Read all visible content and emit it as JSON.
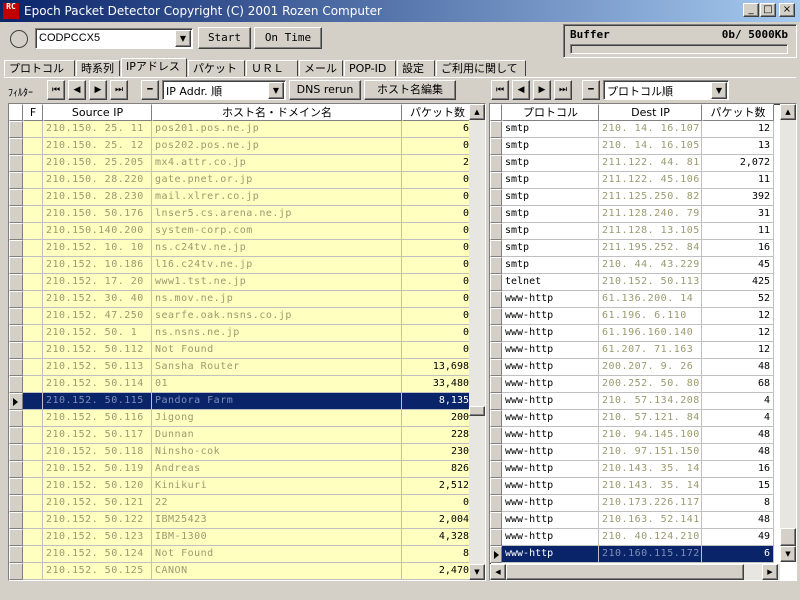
{
  "window": {
    "title": "Epoch Packet Detector   Copyright (C) 2001 Rozen Computer",
    "icon_text": "RC",
    "min_label": "_",
    "max_label": "□",
    "close_label": "×"
  },
  "toolbar": {
    "device": "CODPCCX5",
    "start_label": "Start",
    "ontime_label": "On Time",
    "buffer_label": "Buffer",
    "buffer_value": "0b/  5000Kb",
    "buffer_fill": 0
  },
  "tabs": [
    "プロトコル",
    "時系列",
    "IPアドレス",
    "パケット",
    "ＵＲＬ",
    "メール",
    "POP-ID",
    "設定",
    "ご利用に関して"
  ],
  "active_tab": 2,
  "filter": {
    "label": "ﾌｨﾙﾀｰ",
    "first": "⏮",
    "prev": "◀",
    "next": "▶",
    "last": "⏭",
    "minus": "━",
    "left_sort": "IP Addr. 順",
    "dns_label": "DNS rerun",
    "host_edit_label": "ホスト名編集",
    "right_sort": "プロトコル順"
  },
  "left_grid": {
    "headers": [
      "F",
      "Source IP",
      "ホスト名・ドメイン名",
      "パケット数"
    ],
    "selected_row": 16,
    "rows": [
      {
        "ip": "210.150. 25. 11",
        "host": "pos201.pos.ne.jp",
        "count": "6"
      },
      {
        "ip": "210.150. 25. 12",
        "host": "pos202.pos.ne.jp",
        "count": "0"
      },
      {
        "ip": "210.150. 25.205",
        "host": "mx4.attr.co.jp",
        "count": "2"
      },
      {
        "ip": "210.150. 28.220",
        "host": "gate.pnet.or.jp",
        "count": "0"
      },
      {
        "ip": "210.150. 28.230",
        "host": "mail.xlrer.co.jp",
        "count": "0"
      },
      {
        "ip": "210.150. 50.176",
        "host": "lnser5.cs.arena.ne.jp",
        "count": "0"
      },
      {
        "ip": "210.150.140.200",
        "host": "system-corp.com",
        "count": "0"
      },
      {
        "ip": "210.152. 10. 10",
        "host": "ns.c24tv.ne.jp",
        "count": "0"
      },
      {
        "ip": "210.152. 10.186",
        "host": "l16.c24tv.ne.jp",
        "count": "0"
      },
      {
        "ip": "210.152. 17. 20",
        "host": "www1.tst.ne.jp",
        "count": "0"
      },
      {
        "ip": "210.152. 30. 40",
        "host": "ns.mov.ne.jp",
        "count": "0"
      },
      {
        "ip": "210.152. 47.250",
        "host": "searfe.oak.nsns.co.jp",
        "count": "0"
      },
      {
        "ip": "210.152. 50.  1",
        "host": "ns.nsns.ne.jp",
        "count": "0"
      },
      {
        "ip": "210.152. 50.112",
        "host": "Not Found",
        "count": "0"
      },
      {
        "ip": "210.152. 50.113",
        "host": "Sansha Router",
        "count": "13,698"
      },
      {
        "ip": "210.152. 50.114",
        "host": "01",
        "count": "33,480"
      },
      {
        "ip": "210.152. 50.115",
        "host": "Pandora Farm",
        "count": "8,135"
      },
      {
        "ip": "210.152. 50.116",
        "host": "Jigong",
        "count": "200"
      },
      {
        "ip": "210.152. 50.117",
        "host": "Dunnan",
        "count": "228"
      },
      {
        "ip": "210.152. 50.118",
        "host": "Ninsho-cok",
        "count": "230"
      },
      {
        "ip": "210.152. 50.119",
        "host": "Andreas",
        "count": "826"
      },
      {
        "ip": "210.152. 50.120",
        "host": "Kinikuri",
        "count": "2,512"
      },
      {
        "ip": "210.152. 50.121",
        "host": "22",
        "count": "0"
      },
      {
        "ip": "210.152. 50.122",
        "host": "IBM25423",
        "count": "2,004"
      },
      {
        "ip": "210.152. 50.123",
        "host": "IBM-1300",
        "count": "4,328"
      },
      {
        "ip": "210.152. 50.124",
        "host": "Not Found",
        "count": "8"
      },
      {
        "ip": "210.152. 50.125",
        "host": "CANON",
        "count": "2,470"
      }
    ]
  },
  "right_grid": {
    "headers": [
      "プロトコル",
      "Dest IP",
      "パケット数"
    ],
    "selected_row": 25,
    "rows": [
      {
        "proto": "smtp",
        "ip": "210. 14. 16.107",
        "count": "12"
      },
      {
        "proto": "smtp",
        "ip": "210. 14. 16.105",
        "count": "13"
      },
      {
        "proto": "smtp",
        "ip": "211.122. 44. 81",
        "count": "2,072"
      },
      {
        "proto": "smtp",
        "ip": "211.122. 45.106",
        "count": "11"
      },
      {
        "proto": "smtp",
        "ip": "211.125.250. 82",
        "count": "392"
      },
      {
        "proto": "smtp",
        "ip": "211.128.240. 79",
        "count": "31"
      },
      {
        "proto": "smtp",
        "ip": "211.128. 13.105",
        "count": "11"
      },
      {
        "proto": "smtp",
        "ip": "211.195.252. 84",
        "count": "16"
      },
      {
        "proto": "smtp",
        "ip": "210. 44. 43.229",
        "count": "45"
      },
      {
        "proto": "telnet",
        "ip": "210.152. 50.113",
        "count": "425"
      },
      {
        "proto": "www-http",
        "ip": "61.136.200. 14",
        "count": "52"
      },
      {
        "proto": "www-http",
        "ip": "61.196.  6.110",
        "count": "12"
      },
      {
        "proto": "www-http",
        "ip": "61.196.160.140",
        "count": "12"
      },
      {
        "proto": "www-http",
        "ip": "61.207. 71.163",
        "count": "12"
      },
      {
        "proto": "www-http",
        "ip": "200.207.  9. 26",
        "count": "48"
      },
      {
        "proto": "www-http",
        "ip": "200.252. 50. 80",
        "count": "68"
      },
      {
        "proto": "www-http",
        "ip": "210. 57.134.208",
        "count": "4"
      },
      {
        "proto": "www-http",
        "ip": "210. 57.121. 84",
        "count": "4"
      },
      {
        "proto": "www-http",
        "ip": "210. 94.145.100",
        "count": "48"
      },
      {
        "proto": "www-http",
        "ip": "210. 97.151.150",
        "count": "48"
      },
      {
        "proto": "www-http",
        "ip": "210.143. 35. 14",
        "count": "16"
      },
      {
        "proto": "www-http",
        "ip": "210.143. 35. 14",
        "count": "15"
      },
      {
        "proto": "www-http",
        "ip": "210.173.226.117",
        "count": "8"
      },
      {
        "proto": "www-http",
        "ip": "210.163. 52.141",
        "count": "48"
      },
      {
        "proto": "www-http",
        "ip": "210. 40.124.210",
        "count": "49"
      },
      {
        "proto": "www-http",
        "ip": "210.160.115.172",
        "count": "6"
      }
    ]
  },
  "icons": {
    "scroll_up": "▲",
    "scroll_down": "▼",
    "scroll_left": "◀",
    "scroll_right": "▶",
    "combo": "▼"
  },
  "colors": {
    "titlebar_start": "#0a246a",
    "titlebar_end": "#a6caf0",
    "selection": "#0a246a",
    "row_highlight": "#ffffc0",
    "face": "#d4d0c8"
  }
}
